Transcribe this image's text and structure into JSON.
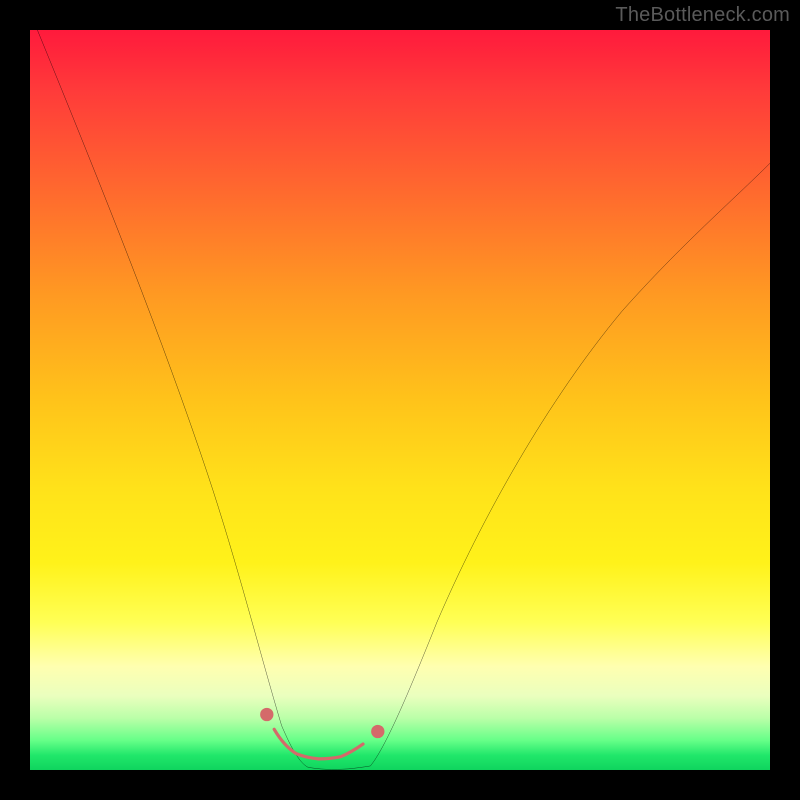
{
  "watermark": "TheBottleneck.com",
  "colors": {
    "background": "#000000",
    "curve_stroke": "#000000",
    "marker_fill": "#d46a6a",
    "marker_stroke": "#d46a6a",
    "gradient_stops": [
      "#ff1a3c",
      "#ff3a3a",
      "#ff6a2e",
      "#ff9a22",
      "#ffc31a",
      "#ffe21a",
      "#fff21a",
      "#ffff55",
      "#ffffb0",
      "#eaffbe",
      "#baffa8",
      "#66ff88",
      "#21e76a",
      "#0fd45e"
    ]
  },
  "chart_data": {
    "type": "line",
    "title": "",
    "xlabel": "",
    "ylabel": "",
    "xlim": [
      0,
      100
    ],
    "ylim": [
      0,
      100
    ],
    "grid": false,
    "legend": false,
    "series": [
      {
        "name": "left-arm",
        "x": [
          1,
          3,
          6,
          9,
          12,
          15,
          18,
          21,
          24,
          26,
          28,
          30,
          32,
          33,
          34,
          35,
          36
        ],
        "y": [
          100,
          92,
          82,
          72,
          63,
          54,
          46,
          38,
          30,
          24,
          18,
          13,
          8,
          5,
          3,
          1.5,
          0.5
        ]
      },
      {
        "name": "right-arm",
        "x": [
          46,
          47,
          48,
          50,
          53,
          57,
          62,
          68,
          74,
          80,
          86,
          92,
          98,
          100
        ],
        "y": [
          0.5,
          2,
          4,
          8,
          15,
          24,
          34,
          45,
          54,
          62,
          69,
          75,
          80,
          82
        ]
      },
      {
        "name": "valley-floor",
        "x": [
          36,
          37,
          38,
          39,
          40,
          41,
          42,
          43,
          44,
          45,
          46
        ],
        "y": [
          0.5,
          0.2,
          0.1,
          0.05,
          0.03,
          0.05,
          0.1,
          0.2,
          0.3,
          0.4,
          0.5
        ]
      }
    ],
    "markers": {
      "name": "highlighted-points",
      "color": "#d46a6a",
      "radius_small": 6,
      "radius_large": 12,
      "x": [
        32,
        33,
        34,
        35,
        36,
        37,
        38,
        39,
        40,
        41,
        42,
        43,
        44,
        46,
        47
      ],
      "y": [
        8,
        5.5,
        3.8,
        2.8,
        2.2,
        1.8,
        1.6,
        1.5,
        1.5,
        1.6,
        1.8,
        2.2,
        2.8,
        4.0,
        5.2
      ],
      "large_indices": [
        0,
        1,
        2,
        3,
        4,
        5,
        6,
        7,
        8,
        9,
        10,
        11,
        12,
        13,
        14
      ],
      "note": "Contiguous blob of salmon markers at the valley bottom; rendered as a thick rounded stroke + a couple of isolated dots."
    }
  }
}
